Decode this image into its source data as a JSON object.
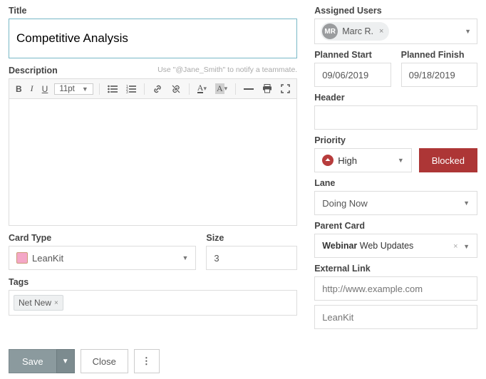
{
  "left": {
    "title_label": "Title",
    "title_value": "Competitive Analysis",
    "description_label": "Description",
    "description_hint": "Use \"@Jane_Smith\" to notify a teammate.",
    "font_size": "11pt",
    "card_type_label": "Card Type",
    "card_type_value": "LeanKit",
    "size_label": "Size",
    "size_value": "3",
    "tags_label": "Tags",
    "tags": [
      {
        "label": "Net New"
      }
    ]
  },
  "right": {
    "assigned_label": "Assigned Users",
    "assigned_user_initials": "MR",
    "assigned_user_name": "Marc R.",
    "planned_start_label": "Planned Start",
    "planned_start_value": "09/06/2019",
    "planned_finish_label": "Planned Finish",
    "planned_finish_value": "09/18/2019",
    "header_label": "Header",
    "header_value": "",
    "priority_label": "Priority",
    "priority_value": "High",
    "blocked_label": "Blocked",
    "lane_label": "Lane",
    "lane_value": "Doing Now",
    "parent_label": "Parent Card",
    "parent_prefix": "Webinar",
    "parent_rest": " Web Updates",
    "external_label": "External Link",
    "external_url_placeholder": "http://www.example.com",
    "external_text_placeholder": "LeanKit"
  },
  "footer": {
    "save": "Save",
    "close": "Close"
  }
}
